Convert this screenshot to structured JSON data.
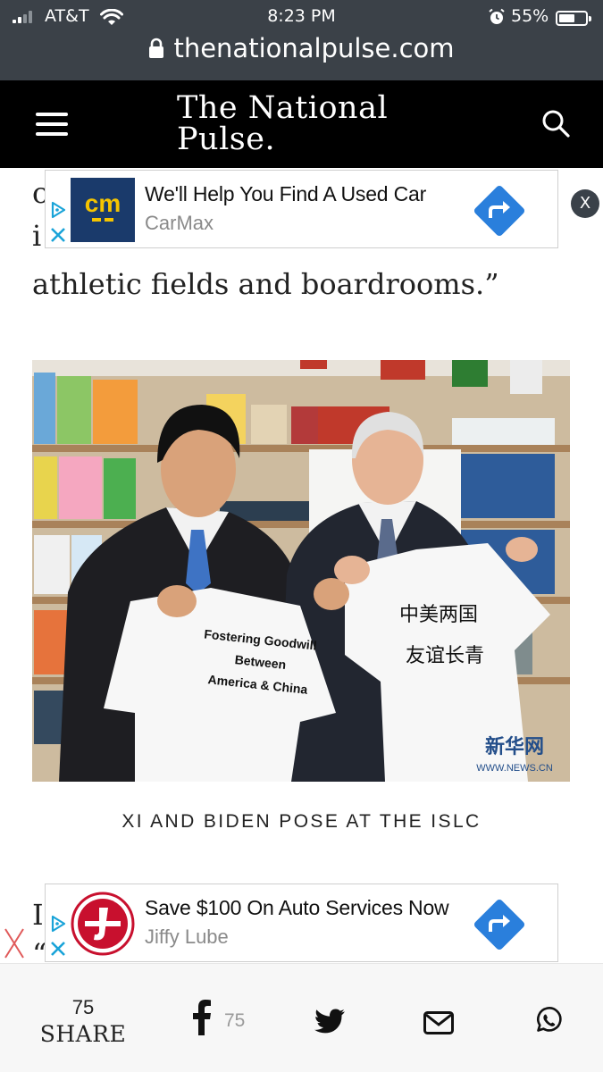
{
  "status_bar": {
    "carrier": "AT&T",
    "time": "8:23 PM",
    "battery": "55%"
  },
  "browser": {
    "url": "thenationalpulse.com"
  },
  "site": {
    "logo_line1": "The National",
    "logo_line2": "Pulse."
  },
  "article": {
    "para1_partial_top": "c",
    "para1_partial_mid": "i",
    "para1_visible_end": "athletic fields and boardrooms.”",
    "photo_caption": "XI AND BIDEN POSE AT THE ISLC",
    "para2_partial_top": "I",
    "para2_partial_mid": "“",
    "photo_text": {
      "shirt_left": [
        "Fostering Goodwill",
        "Between",
        "America & China"
      ],
      "shirt_right": [
        "中美两国",
        "友谊长青"
      ],
      "watermark_cn": "新华网",
      "watermark_url": "WWW.NEWS.CN"
    }
  },
  "ads": [
    {
      "title": "We'll Help You Find A Used Car",
      "advertiser": "CarMax",
      "logo_text": "cm",
      "brand_color": "#1a3a6b",
      "accent_color": "#f5c400"
    },
    {
      "title": "Save $100 On Auto Services Now",
      "advertiser": "Jiffy Lube",
      "brand_color": "#c8102e"
    }
  ],
  "overlay": {
    "close_label": "X"
  },
  "share_bar": {
    "count": "75",
    "label": "SHARE",
    "facebook_count": "75"
  },
  "colors": {
    "chrome": "#3b4148",
    "header": "#000000",
    "ad_arrow": "#2a7fdc",
    "adchoices": "#19a3d8"
  }
}
